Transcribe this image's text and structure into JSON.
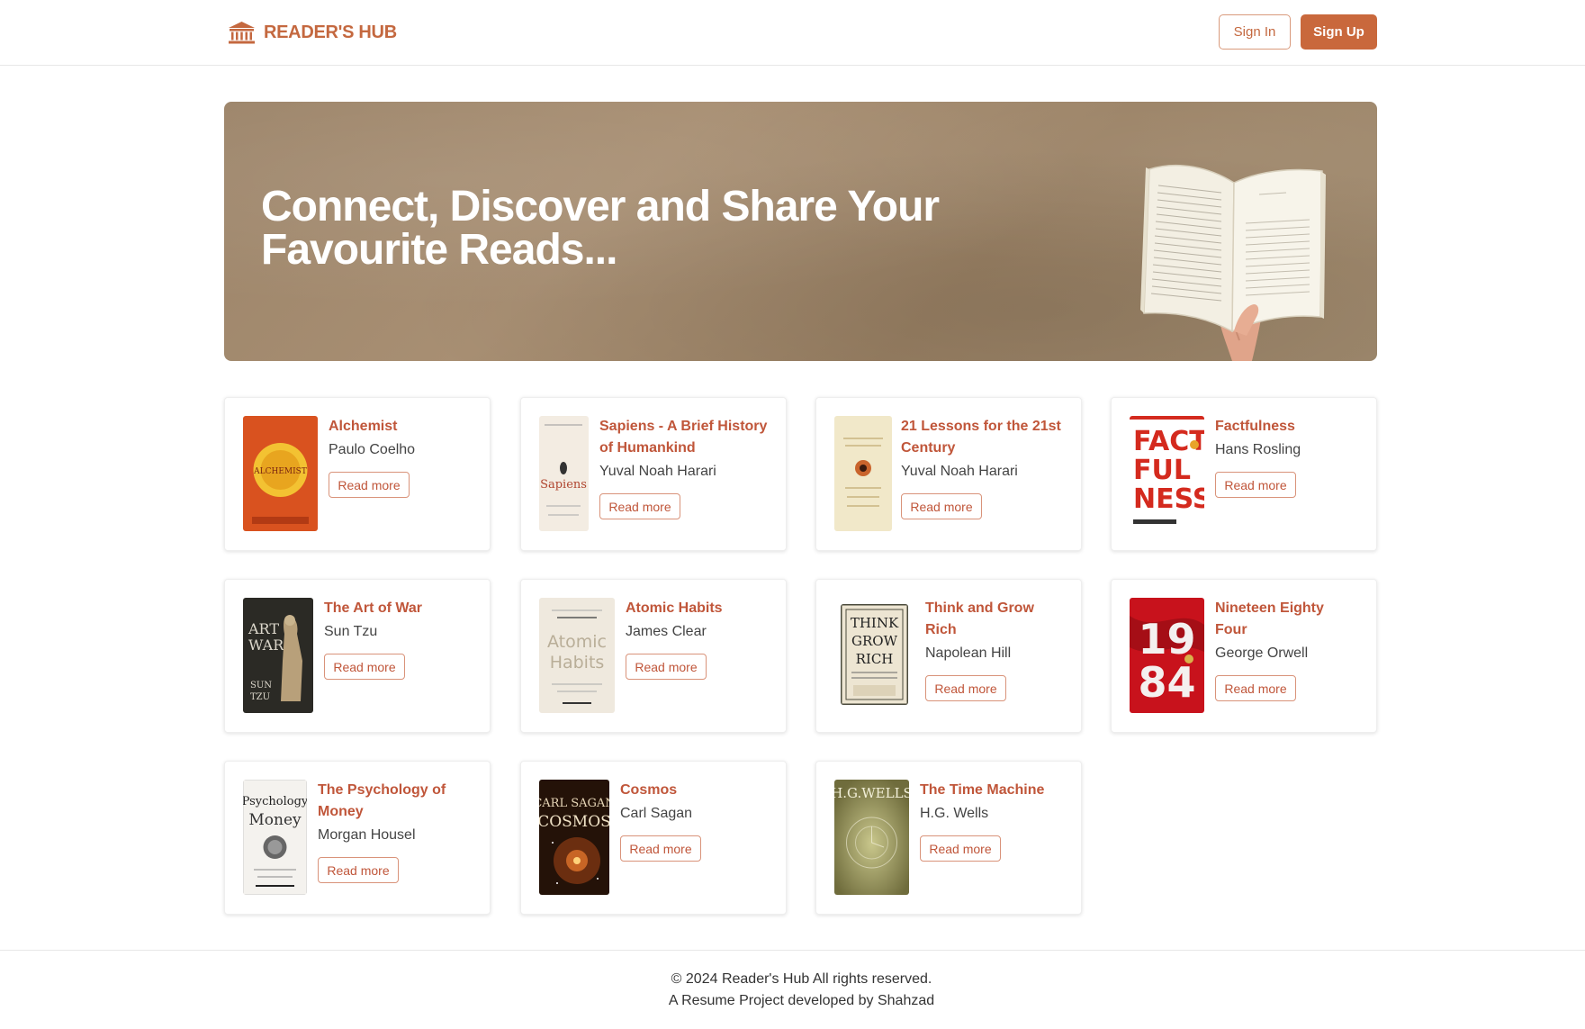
{
  "header": {
    "brand": "READER'S HUB",
    "signin_label": "Sign In",
    "signup_label": "Sign Up"
  },
  "hero": {
    "title": "Connect, Discover and Share Your Favourite Reads..."
  },
  "books": [
    {
      "title": "Alchemist",
      "author": "Paulo Coelho",
      "cta": "Read more",
      "cover_color": "#d9521f"
    },
    {
      "title": "Sapiens - A Brief History of Humankind",
      "author": "Yuval Noah Harari",
      "cta": "Read more",
      "cover_color": "#f3ece2"
    },
    {
      "title": "21 Lessons for the 21st Century",
      "author": "Yuval Noah Harari",
      "cta": "Read more",
      "cover_color": "#f1e8c9"
    },
    {
      "title": "Factfulness",
      "author": "Hans Rosling",
      "cta": "Read more",
      "cover_color": "#ffffff"
    },
    {
      "title": "The Art of War",
      "author": "Sun Tzu",
      "cta": "Read more",
      "cover_color": "#2b2a25"
    },
    {
      "title": "Atomic Habits",
      "author": "James Clear",
      "cta": "Read more",
      "cover_color": "#efe9de"
    },
    {
      "title": "Think and Grow Rich",
      "author": "Napolean Hill",
      "cta": "Read more",
      "cover_color": "#ede5d2"
    },
    {
      "title": "Nineteen Eighty Four",
      "author": "George Orwell",
      "cta": "Read more",
      "cover_color": "#c8121c"
    },
    {
      "title": "The Psychology of Money",
      "author": "Morgan Housel",
      "cta": "Read more",
      "cover_color": "#f4f2ee"
    },
    {
      "title": "Cosmos",
      "author": "Carl Sagan",
      "cta": "Read more",
      "cover_color": "#241208"
    },
    {
      "title": "The Time Machine",
      "author": "H.G. Wells",
      "cta": "Read more",
      "cover_color": "#8d8a52"
    }
  ],
  "footer": {
    "copyright": "© 2024 Reader's Hub All rights reserved.",
    "credit": "A Resume Project developed by Shahzad"
  },
  "colors": {
    "brand": "#c4683f",
    "accent_button": "#c9683c",
    "title_text": "#c0563a"
  }
}
